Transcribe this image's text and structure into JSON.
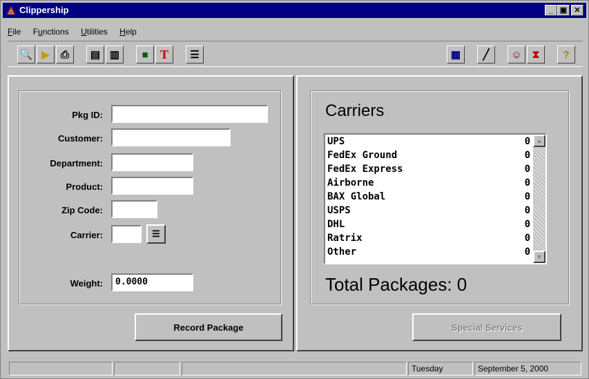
{
  "window": {
    "title": "Clippership"
  },
  "menu": [
    {
      "label": "File",
      "accel": "F",
      "rest": "ile"
    },
    {
      "label": "Functions",
      "pre": "F",
      "accel": "u",
      "rest": "nctions"
    },
    {
      "label": "Utilities",
      "accel": "U",
      "rest": "tilities"
    },
    {
      "label": "Help",
      "accel": "H",
      "rest": "elp"
    }
  ],
  "toolbar_left": [
    "find-package-icon",
    "open-folder-icon",
    "printer-icon",
    "document-icon",
    "notes-icon",
    "printer-stack-icon",
    "text-t-icon",
    "list-icon"
  ],
  "toolbar_right": [
    "calendar-icon",
    "sweep-icon",
    "user-icon",
    "hourglass-icon",
    "help-icon"
  ],
  "form": {
    "pkg_id_label": "Pkg ID:",
    "pkg_id_value": "",
    "customer_label": "Customer:",
    "customer_value": "",
    "department_label": "Department:",
    "department_value": "",
    "product_label": "Product:",
    "product_value": "",
    "zip_label": "Zip Code:",
    "zip_value": "",
    "carrier_label": "Carrier:",
    "carrier_value": "",
    "weight_label": "Weight:",
    "weight_value": "0.0000",
    "record_button": "Record Package"
  },
  "carriers": {
    "title": "Carriers",
    "items": [
      {
        "name": "UPS",
        "count": "0"
      },
      {
        "name": "FedEx Ground",
        "count": "0"
      },
      {
        "name": "FedEx Express",
        "count": "0"
      },
      {
        "name": "Airborne",
        "count": "0"
      },
      {
        "name": "BAX Global",
        "count": "0"
      },
      {
        "name": "USPS",
        "count": "0"
      },
      {
        "name": "DHL",
        "count": "0"
      },
      {
        "name": "Ratrix",
        "count": "0"
      },
      {
        "name": "Other",
        "count": "0"
      }
    ],
    "total_label": "Total Packages:",
    "total_value": "0",
    "special_button": "Special Services"
  },
  "statusbar": {
    "day": "Tuesday",
    "date": "September 5, 2000"
  }
}
